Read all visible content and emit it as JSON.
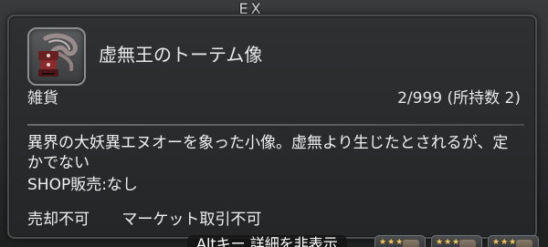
{
  "header": {
    "tag": "EX"
  },
  "item": {
    "name": "虚無王のトーテム像",
    "category": "雑貨",
    "stack": "2/999 (所持数 2)",
    "icon": "totem-statue-icon",
    "description": "異界の大妖異エヌオーを象った小像。虚無より生じたとされるが、定かでない",
    "shop": "SHOP販売:なし",
    "flags": [
      "売却不可",
      "マーケット取引不可"
    ]
  },
  "hint": {
    "text": "Altキー 詳細を非表示"
  },
  "colors": {
    "tooltip_bg": "#2a2b2c",
    "text": "#f0f0f0",
    "star": "#f0c75a"
  }
}
